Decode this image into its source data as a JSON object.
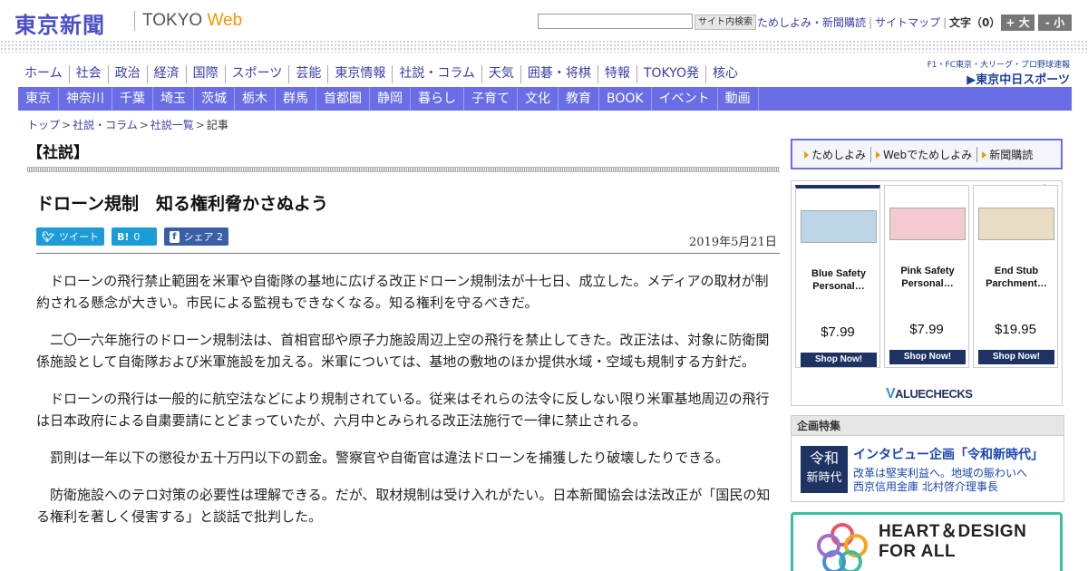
{
  "header": {
    "logo_jp": "東京新聞",
    "logo_en_main": "TOKYO ",
    "logo_en_web": "Web",
    "search_placeholder": "",
    "search_button": "サイト内検索",
    "links": [
      "ためしよみ・新聞購読",
      "サイトマップ"
    ],
    "font_size_label": "文字（0）",
    "font_bigger": "+ 大",
    "font_smaller": "- 小"
  },
  "main_nav": [
    "ホーム",
    "社会",
    "政治",
    "経済",
    "国際",
    "スポーツ",
    "芸能",
    "東京情報",
    "社説・コラム",
    "天気",
    "囲碁・将棋",
    "特報",
    "TOKYO発",
    "核心"
  ],
  "chunichi": {
    "top": "F1・FC東京・大リーグ・プロ野球速報",
    "main": "▶東京中日スポーツ"
  },
  "sub_nav": [
    "東京",
    "神奈川",
    "千葉",
    "埼玉",
    "茨城",
    "栃木",
    "群馬",
    "首都圏",
    "静岡",
    "暮らし",
    "子育て",
    "文化",
    "教育",
    "BOOK",
    "イベント",
    "動画"
  ],
  "breadcrumb": [
    "トップ",
    "社説・コラム",
    "社説一覧",
    "記事"
  ],
  "article": {
    "section": "【社説】",
    "title": "ドローン規制　知る権利脅かさぬよう",
    "date": "2019年5月21日",
    "share": {
      "tweet": "ツイート",
      "hatena_count": "0",
      "fb_label": "シェア",
      "fb_count": "2"
    },
    "paragraphs": [
      "ドローンの飛行禁止範囲を米軍や自衛隊の基地に広げる改正ドローン規制法が十七日、成立した。メディアの取材が制約される懸念が大きい。市民による監視もできなくなる。知る権利を守るべきだ。",
      "二〇一六年施行のドローン規制法は、首相官邸や原子力施設周辺上空の飛行を禁止してきた。改正法は、対象に防衛関係施設として自衛隊および米軍施設を加える。米軍については、基地の敷地のほか提供水域・空域も規制する方針だ。",
      "ドローンの飛行は一般的に航空法などにより規制されている。従来はそれらの法令に反しない限り米軍基地周辺の飛行は日本政府による自粛要請にとどまっていたが、六月中とみられる改正法施行で一律に禁止される。",
      "罰則は一年以下の懲役か五十万円以下の罰金。警察官や自衛官は違法ドローンを捕獲したり破壊したりできる。",
      "防衛施設へのテロ対策の必要性は理解できる。だが、取材規制は受け入れがたい。日本新聞協会は法改正が「国民の知る権利を著しく侵害する」と談話で批判した。"
    ]
  },
  "sidebar": {
    "promo_tabs": [
      "ためしよみ",
      "Webでためしよみ",
      "新聞購読"
    ],
    "ad": {
      "info_icon": "info-icon",
      "products": [
        {
          "name": "Blue Safety Personal…",
          "price": "$7.99",
          "cta": "Shop Now!",
          "color": "#bcd6e8"
        },
        {
          "name": "Pink Safety Personal…",
          "price": "$7.99",
          "cta": "Shop Now!",
          "color": "#f3c9d2"
        },
        {
          "name": "End Stub Parchment…",
          "price": "$19.95",
          "cta": "Shop Now!",
          "color": "#e8dcc4"
        }
      ],
      "brand_v": "V",
      "brand_rest": "ALUECHECKS"
    },
    "feature": {
      "heading": "企画特集",
      "thumb_line1": "令和",
      "thumb_line2": "新時代",
      "title": "インタビュー企画「令和新時代」",
      "line1": "改革は堅実利益へ。地域の賑わいへ",
      "line2": "西京信用金庫 北村啓介理事長"
    },
    "banner": {
      "line1": "HEART＆DESIGN",
      "line2": "FOR ALL"
    }
  }
}
